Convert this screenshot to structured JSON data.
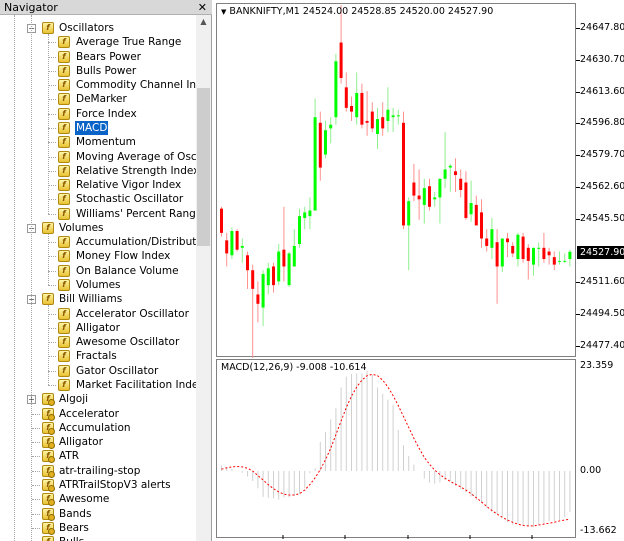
{
  "navigator": {
    "title": "Navigator",
    "close_icon": "close-icon",
    "groups": [
      {
        "label": "Oscillators",
        "expanded": true,
        "items": [
          "Average True Range",
          "Bears Power",
          "Bulls Power",
          "Commodity Channel Index",
          "DeMarker",
          "Force Index",
          "MACD",
          "Momentum",
          "Moving Average of Oscillator",
          "Relative Strength Index",
          "Relative Vigor Index",
          "Stochastic Oscillator",
          "Williams' Percent Range"
        ]
      },
      {
        "label": "Volumes",
        "expanded": true,
        "items": [
          "Accumulation/Distribution",
          "Money Flow Index",
          "On Balance Volume",
          "Volumes"
        ]
      },
      {
        "label": "Bill Williams",
        "expanded": true,
        "items": [
          "Accelerator Oscillator",
          "Alligator",
          "Awesome Oscillator",
          "Fractals",
          "Gator Oscillator",
          "Market Facilitation Index"
        ]
      }
    ],
    "selected": "MACD",
    "custom_folder": {
      "label": "Algoji",
      "expanded": false
    },
    "custom_items": [
      "Accelerator",
      "Accumulation",
      "Alligator",
      "ATR",
      "atr-trailing-stop",
      "ATRTrailStopV3 alerts",
      "Awesome",
      "Bands",
      "Bears",
      "Bulls"
    ]
  },
  "chart": {
    "title": "BANKNIFTY,M1  24524.00 24528.85 24520.00 24527.90",
    "price_axis": [
      "24647.80",
      "24630.70",
      "24613.60",
      "24596.80",
      "24579.70",
      "24562.60",
      "24545.50",
      "24511.60",
      "24494.50",
      "24477.40"
    ],
    "current_price": "24527.90",
    "colors": {
      "bull": "#00ff00",
      "bear": "#ff0000",
      "bull_wick": "#90f090",
      "bear_wick": "#ff9090",
      "macd_hist": "#d0d0d0",
      "signal": "#ff0000"
    }
  },
  "macd": {
    "title": "MACD(12,26,9) -9.008 -10.614",
    "axis": [
      "23.359",
      "0.00",
      "-13.662"
    ]
  },
  "chart_data": [
    {
      "type": "candlestick",
      "symbol": "BANKNIFTY",
      "timeframe": "M1",
      "ylim": [
        24470,
        24660
      ],
      "ohlc": [
        [
          24551,
          24552,
          24536,
          24538
        ],
        [
          24534,
          24538,
          24520,
          24527
        ],
        [
          24526,
          24541,
          24524,
          24539
        ],
        [
          24539,
          24540,
          24528,
          24529
        ],
        [
          24530,
          24535,
          24522,
          24531
        ],
        [
          24526,
          24528,
          24508,
          24518
        ],
        [
          24518,
          24521,
          24470,
          24508
        ],
        [
          24505,
          24512,
          24490,
          24500
        ],
        [
          24498,
          24518,
          24488,
          24516
        ],
        [
          24510,
          24522,
          24505,
          24519
        ],
        [
          24520,
          24522,
          24506,
          24510
        ],
        [
          24512,
          24532,
          24510,
          24528
        ],
        [
          24529,
          24552,
          24512,
          24520
        ],
        [
          24510,
          24528,
          24509,
          24527
        ],
        [
          24520,
          24540,
          24520,
          24531
        ],
        [
          24532,
          24551,
          24530,
          24547
        ],
        [
          24546,
          24552,
          24540,
          24549
        ],
        [
          24547,
          24557,
          24540,
          24550
        ],
        [
          24550,
          24610,
          24550,
          24600
        ],
        [
          24597,
          24603,
          24566,
          24573
        ],
        [
          24580,
          24598,
          24578,
          24593
        ],
        [
          24594,
          24600,
          24586,
          24596
        ],
        [
          24600,
          24634,
          24596,
          24630
        ],
        [
          24640,
          24660,
          24618,
          24621
        ],
        [
          24616,
          24624,
          24603,
          24605
        ],
        [
          24606,
          24611,
          24598,
          24603
        ],
        [
          24600,
          24624,
          24596,
          24613
        ],
        [
          24613,
          24618,
          24594,
          24596
        ],
        [
          24598,
          24614,
          24590,
          24597
        ],
        [
          24603,
          24608,
          24592,
          24594
        ],
        [
          24591,
          24605,
          24583,
          24599
        ],
        [
          24600,
          24608,
          24590,
          24594
        ],
        [
          24598,
          24616,
          24592,
          24604
        ],
        [
          24600,
          24605,
          24592,
          24601
        ],
        [
          24601,
          24604,
          24596,
          24601
        ],
        [
          24597,
          24603,
          24540,
          24542
        ],
        [
          24542,
          24557,
          24518,
          24555
        ],
        [
          24565,
          24575,
          24555,
          24558
        ],
        [
          24558,
          24572,
          24545,
          24556
        ],
        [
          24553,
          24567,
          24543,
          24562
        ],
        [
          24563,
          24567,
          24550,
          24552
        ],
        [
          24556,
          24560,
          24552,
          24557
        ],
        [
          24557,
          24567,
          24543,
          24567
        ],
        [
          24567,
          24592,
          24562,
          24572
        ],
        [
          24573,
          24575,
          24560,
          24574
        ],
        [
          24571,
          24578,
          24560,
          24569
        ],
        [
          24567,
          24572,
          24557,
          24561
        ],
        [
          24565,
          24571,
          24545,
          24546
        ],
        [
          24548,
          24566,
          24544,
          24554
        ],
        [
          24553,
          24558,
          24543,
          24542
        ],
        [
          24549,
          24556,
          24530,
          24535
        ],
        [
          24535,
          24540,
          24528,
          24531
        ],
        [
          24530,
          24546,
          24524,
          24540
        ],
        [
          24533,
          24540,
          24500,
          24520
        ],
        [
          24520,
          24535,
          24517,
          24535
        ],
        [
          24535,
          24538,
          24525,
          24533
        ],
        [
          24531,
          24533,
          24525,
          24527
        ],
        [
          24524,
          24538,
          24520,
          24537
        ],
        [
          24536,
          24538,
          24522,
          24524
        ],
        [
          24530,
          24532,
          24513,
          24523
        ],
        [
          24521,
          24530,
          24515,
          24530
        ],
        [
          24530,
          24533,
          24520,
          24530
        ],
        [
          24530,
          24538,
          24522,
          24524
        ],
        [
          24528,
          24530,
          24521,
          24526
        ],
        [
          24525,
          24528,
          24518,
          24521
        ],
        [
          24523,
          24528,
          24521,
          24523
        ],
        [
          24523,
          24527,
          24522,
          24523
        ],
        [
          24524,
          24528.85,
          24520,
          24527.9
        ]
      ]
    },
    {
      "type": "bar+line",
      "title": "MACD(12,26,9) -9.008 -10.614",
      "ylim": [
        -13.662,
        23.359
      ],
      "series": [
        {
          "name": "MACD",
          "type": "bar",
          "values": [
            1.2,
            0.9,
            0.5,
            0,
            -0.4,
            -1.2,
            -2.2,
            -3.8,
            -5.7,
            -5.9,
            -6,
            -6.3,
            -5.8,
            -5.8,
            -5.5,
            -5,
            -3.8,
            -0.5,
            0.6,
            6.4,
            8.6,
            11.4,
            13.9,
            18.4,
            20.8,
            21.4,
            21.5,
            21.5,
            22,
            21.2,
            18.4,
            17,
            15.7,
            14.5,
            9.1,
            5.7,
            3.3,
            1.4,
            0,
            -1.7,
            -2.6,
            -2.8,
            -2.5,
            -2,
            -2.2,
            -3.3,
            -4,
            -4.7,
            -5.6,
            -6.4,
            -7.1,
            -8.1,
            -9,
            -9.5,
            -10,
            -11.3,
            -11.8,
            -11.7,
            -12,
            -12.3,
            -12.4,
            -12,
            -11.8,
            -11.1,
            -11,
            -10.8,
            -10.2,
            -9.008
          ]
        },
        {
          "name": "Signal",
          "type": "line",
          "values": [
            0.4,
            0.7,
            0.9,
            1,
            0.9,
            0.6,
            0,
            -1,
            -2,
            -3,
            -3.9,
            -4.6,
            -5.1,
            -5.3,
            -5.3,
            -5,
            -4.2,
            -3,
            -1.5,
            0.3,
            2.5,
            5,
            8,
            11,
            14,
            16.5,
            18.5,
            20,
            21,
            21.3,
            21,
            20,
            18.5,
            16.6,
            14.4,
            12,
            9.6,
            7.2,
            5,
            3,
            1.5,
            0.2,
            -0.8,
            -1.6,
            -2.3,
            -2.9,
            -3.5,
            -4.2,
            -5,
            -5.9,
            -6.8,
            -7.8,
            -8.7,
            -9.5,
            -10.2,
            -10.8,
            -11.3,
            -11.7,
            -12,
            -12.1,
            -12.1,
            -11.9,
            -11.7,
            -11.5,
            -11.3,
            -11,
            -10.8,
            -10.614
          ]
        }
      ]
    }
  ]
}
